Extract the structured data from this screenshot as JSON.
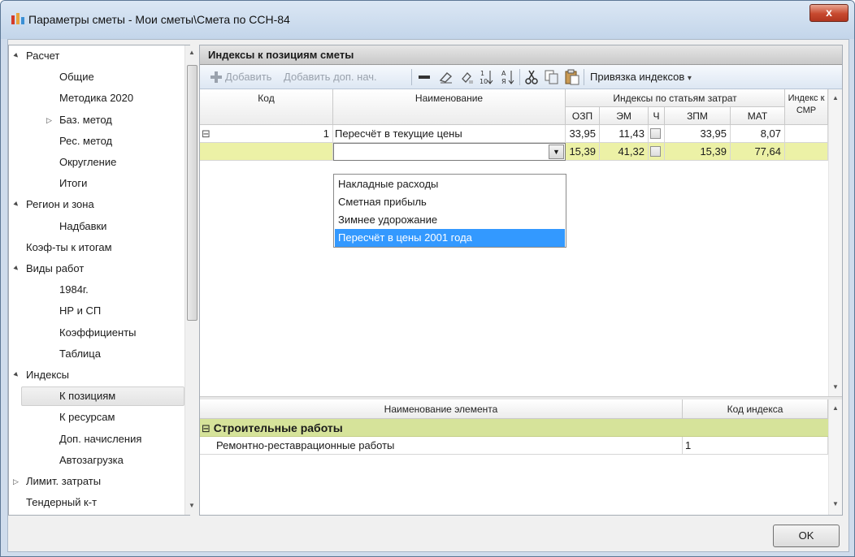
{
  "window": {
    "title": "Параметры сметы - Мои сметы\\Смета по ССН-84",
    "close_label": "x"
  },
  "nav": {
    "items": [
      {
        "label": "Расчет",
        "level": 0,
        "expander": "▲"
      },
      {
        "label": "Общие",
        "level": 1
      },
      {
        "label": "Методика 2020",
        "level": 1
      },
      {
        "label": "Баз. метод",
        "level": 1,
        "expander": "▷"
      },
      {
        "label": "Рес. метод",
        "level": 1
      },
      {
        "label": "Округление",
        "level": 1
      },
      {
        "label": "Итоги",
        "level": 1
      },
      {
        "label": "Регион и зона",
        "level": 0,
        "expander": "▲"
      },
      {
        "label": "Надбавки",
        "level": 1
      },
      {
        "label": "Коэф-ты к итогам",
        "level": 0
      },
      {
        "label": "Виды работ",
        "level": 0,
        "expander": "▲"
      },
      {
        "label": "1984г.",
        "level": 1
      },
      {
        "label": "НР и СП",
        "level": 1
      },
      {
        "label": "Коэффициенты",
        "level": 1
      },
      {
        "label": "Таблица",
        "level": 1
      },
      {
        "label": "Индексы",
        "level": 0,
        "expander": "▲"
      },
      {
        "label": "К позициям",
        "level": 1
      },
      {
        "label": "К ресурсам",
        "level": 1
      },
      {
        "label": "Доп. начисления",
        "level": 1
      },
      {
        "label": "Автозагрузка",
        "level": 1
      },
      {
        "label": "Лимит. затраты",
        "level": 0,
        "expander": "▷"
      },
      {
        "label": "Тендерный к-т",
        "level": 0
      }
    ],
    "selected": "К позициям"
  },
  "pane": {
    "title": "Индексы к позициям сметы",
    "toolbar": {
      "add": "Добавить",
      "add_extra": "Добавить доп. нач.",
      "binding": "Привязка индексов",
      "binding_arrow": "▾"
    },
    "columns": {
      "code": "Код",
      "name": "Наименование",
      "cost_group": "Индексы по статьям затрат",
      "smr": "Индекс к СМР",
      "ozp": "ОЗП",
      "em": "ЭМ",
      "ch": "Ч",
      "zpm": "ЗПМ",
      "mat": "МАТ"
    },
    "rows": [
      {
        "expander": "⊟",
        "code": "1",
        "name": "Пересчёт в текущие цены",
        "ozp": "33,95",
        "em": "11,43",
        "zpm": "33,95",
        "mat": "8,07"
      },
      {
        "code": "",
        "name": "",
        "ozp": "15,39",
        "em": "41,32",
        "zpm": "15,39",
        "mat": "77,64"
      }
    ],
    "dropdown_options": [
      "Накладные расходы",
      "Сметная прибыль",
      "Зимнее удорожание",
      "Пересчёт в цены 2001 года"
    ],
    "dropdown_selected": "Пересчёт в цены 2001 года",
    "lower": {
      "col_name": "Наименование элемента",
      "col_code": "Код индекса",
      "group": "Строительные работы",
      "group_expander": "⊟",
      "rows": [
        {
          "name": "Ремонтно-реставрационные работы",
          "code": "1"
        }
      ]
    }
  },
  "buttons": {
    "ok": "OK"
  },
  "colors": {
    "selection": "#3399ff",
    "yellow_row": "#ecf1a6",
    "group_row": "#d6e39a"
  }
}
